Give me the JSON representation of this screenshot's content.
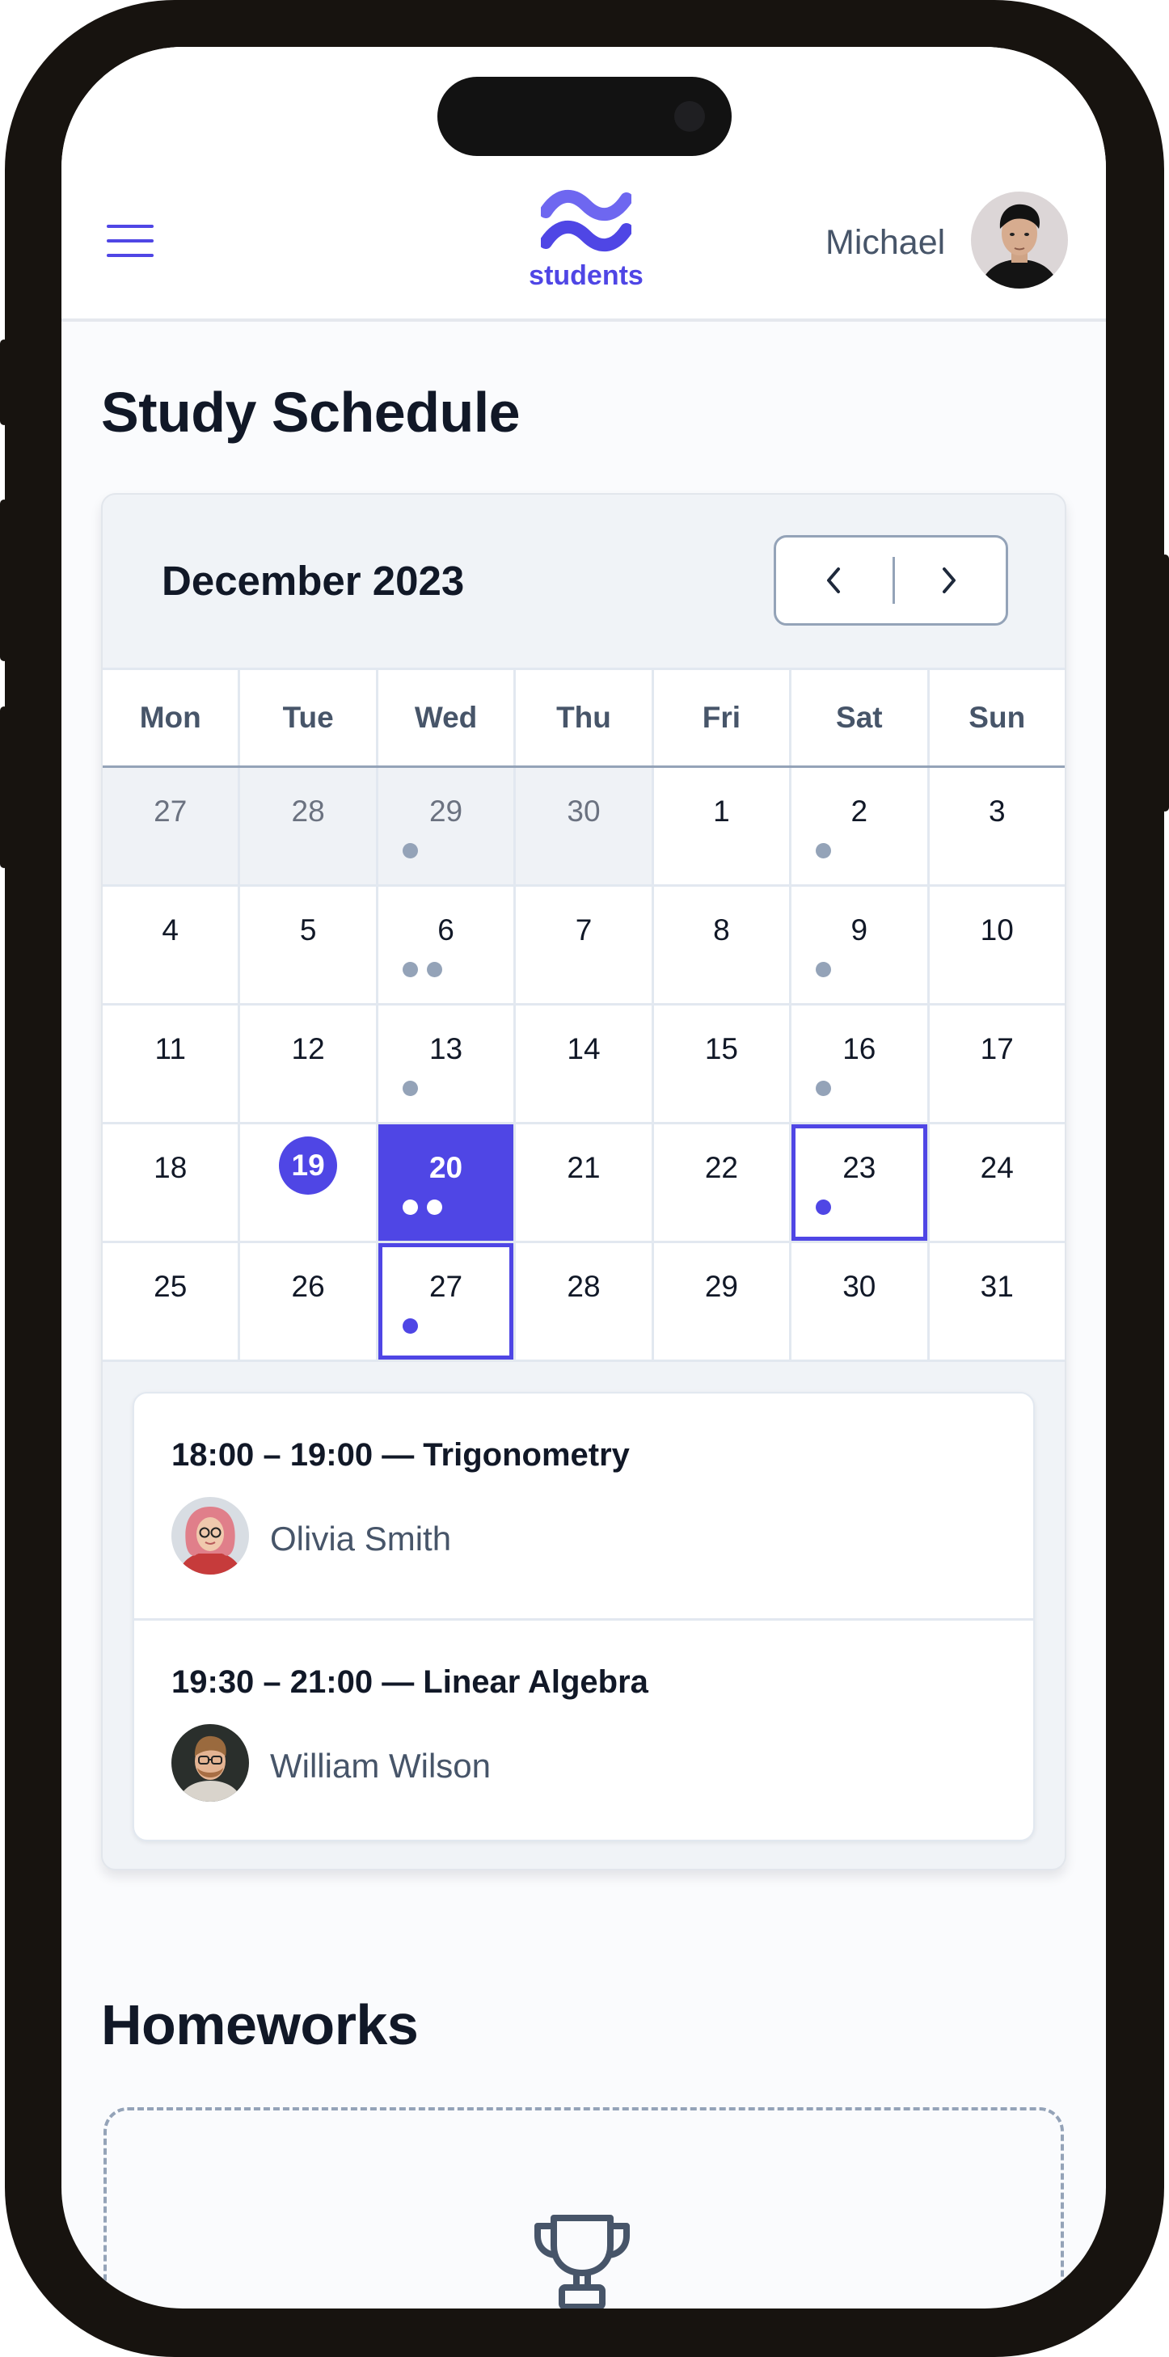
{
  "header": {
    "logo_text": "students",
    "user_name": "Michael"
  },
  "schedule": {
    "title": "Study Schedule",
    "month_label": "December 2023",
    "weekdays": [
      "Mon",
      "Tue",
      "Wed",
      "Thu",
      "Fri",
      "Sat",
      "Sun"
    ],
    "weeks": [
      [
        {
          "day": "27",
          "muted": true
        },
        {
          "day": "28",
          "muted": true
        },
        {
          "day": "29",
          "muted": true,
          "dots": 1
        },
        {
          "day": "30",
          "muted": true
        },
        {
          "day": "1"
        },
        {
          "day": "2",
          "dots": 1
        },
        {
          "day": "3"
        }
      ],
      [
        {
          "day": "4"
        },
        {
          "day": "5"
        },
        {
          "day": "6",
          "dots": 2
        },
        {
          "day": "7"
        },
        {
          "day": "8"
        },
        {
          "day": "9",
          "dots": 1
        },
        {
          "day": "10"
        }
      ],
      [
        {
          "day": "11"
        },
        {
          "day": "12"
        },
        {
          "day": "13",
          "dots": 1
        },
        {
          "day": "14"
        },
        {
          "day": "15"
        },
        {
          "day": "16",
          "dots": 1
        },
        {
          "day": "17"
        }
      ],
      [
        {
          "day": "18"
        },
        {
          "day": "19",
          "state": "today"
        },
        {
          "day": "20",
          "state": "selected",
          "dots": 2
        },
        {
          "day": "21"
        },
        {
          "day": "22"
        },
        {
          "day": "23",
          "state": "outlined",
          "dots": 1
        },
        {
          "day": "24"
        }
      ],
      [
        {
          "day": "25"
        },
        {
          "day": "26"
        },
        {
          "day": "27",
          "state": "outlined",
          "dots": 1
        },
        {
          "day": "28"
        },
        {
          "day": "29"
        },
        {
          "day": "30"
        },
        {
          "day": "31"
        }
      ]
    ],
    "events": [
      {
        "title": "18:00 – 19:00 — Trigonometry",
        "person": "Olivia Smith"
      },
      {
        "title": "19:30 – 21:00 — Linear Algebra",
        "person": "William Wilson"
      }
    ]
  },
  "homeworks": {
    "title": "Homeworks"
  },
  "colors": {
    "accent": "#4f46e5",
    "muted_dot": "#94a3b8",
    "text_dark": "#111827"
  },
  "icons": [
    "menu-icon",
    "students-logo-icon",
    "chevron-left-icon",
    "chevron-right-icon",
    "trophy-icon"
  ]
}
